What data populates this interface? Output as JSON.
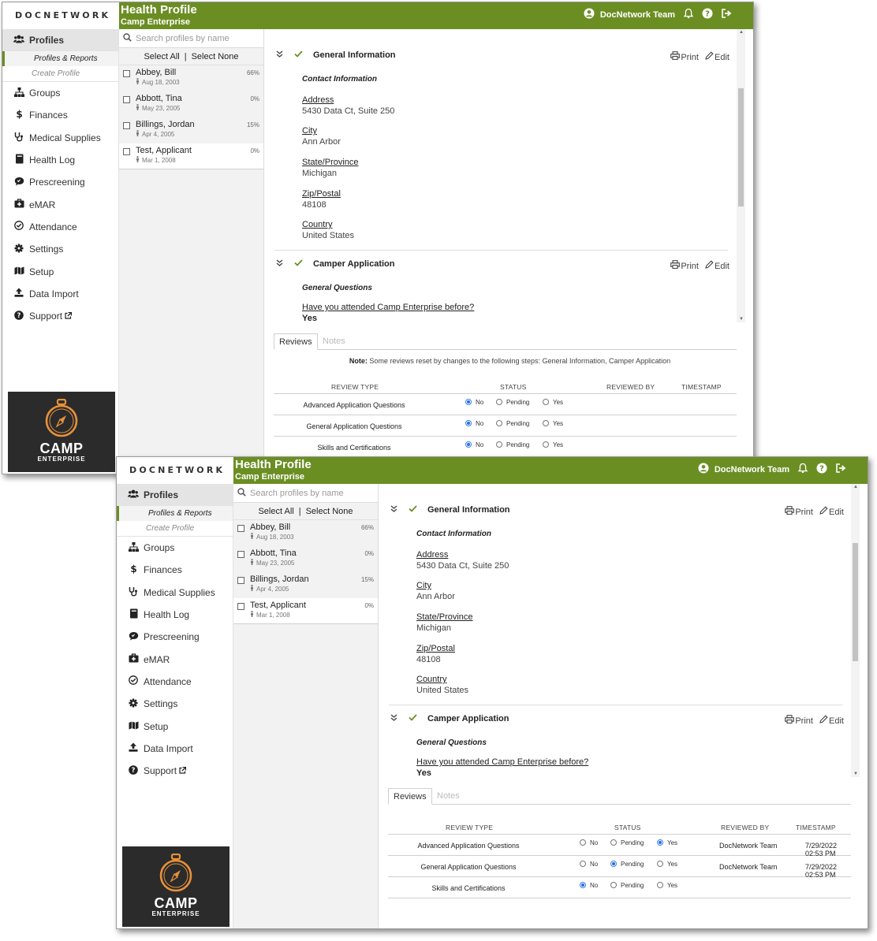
{
  "app": {
    "logo_text": "DOCNETWORK",
    "title": "Health Profile",
    "subtitle": "Camp Enterprise",
    "user_name": "DocNetwork Team"
  },
  "sidebar": {
    "active_item": "Profiles",
    "sub_items": [
      "Profiles & Reports",
      "Create Profile"
    ],
    "items": [
      {
        "label": "Groups",
        "icon": "sitemap-icon"
      },
      {
        "label": "Finances",
        "icon": "dollar-icon"
      },
      {
        "label": "Medical Supplies",
        "icon": "stethoscope-icon"
      },
      {
        "label": "Health Log",
        "icon": "book-icon"
      },
      {
        "label": "Prescreening",
        "icon": "chat-icon"
      },
      {
        "label": "eMAR",
        "icon": "medkit-icon"
      },
      {
        "label": "Attendance",
        "icon": "check-circle-icon"
      },
      {
        "label": "Settings",
        "icon": "gear-icon"
      },
      {
        "label": "Setup",
        "icon": "map-icon"
      },
      {
        "label": "Data Import",
        "icon": "upload-icon"
      },
      {
        "label": "Support",
        "icon": "question-circle-icon"
      }
    ],
    "brand": {
      "line1": "CAMP",
      "line2": "ENTERPRISE"
    }
  },
  "profiles": {
    "search_placeholder": "Search profiles by name",
    "select_all": "Select All",
    "select_separator": "|",
    "select_none": "Select None",
    "list": [
      {
        "name": "Abbey, Bill",
        "date": "Aug 18, 2003",
        "pct": "66%"
      },
      {
        "name": "Abbott, Tina",
        "date": "May 23, 2005",
        "pct": "0%"
      },
      {
        "name": "Billings, Jordan",
        "date": "Apr 4, 2005",
        "pct": "15%"
      },
      {
        "name": "Test, Applicant",
        "date": "Mar 1, 2008",
        "pct": "0%"
      }
    ]
  },
  "form": {
    "print_label": "Print",
    "edit_label": "Edit",
    "general": {
      "title": "General Information",
      "subheading": "Contact Information",
      "fields": [
        {
          "label": "Address",
          "value": "5430 Data Ct, Suite 250"
        },
        {
          "label": "City",
          "value": "Ann Arbor"
        },
        {
          "label": "State/Province",
          "value": "Michigan"
        },
        {
          "label": "Zip/Postal",
          "value": "48108"
        },
        {
          "label": "Country",
          "value": "United States"
        }
      ]
    },
    "camper": {
      "title": "Camper Application",
      "subheading": "General Questions",
      "question": "Have you attended Camp Enterprise before?",
      "answer": "Yes"
    }
  },
  "reviews": {
    "tabs": [
      "Reviews",
      "Notes"
    ],
    "note_label": "Note:",
    "note_text": "Some reviews reset by changes to the following steps: General Information, Camper Application",
    "headers": [
      "REVIEW TYPE",
      "STATUS",
      "REVIEWED BY",
      "TIMESTAMP"
    ],
    "status_options": [
      "No",
      "Pending",
      "Yes"
    ],
    "before": [
      {
        "type": "Advanced Application Questions",
        "status": "No",
        "by": "",
        "ts": ""
      },
      {
        "type": "General Application Questions",
        "status": "No",
        "by": "",
        "ts": ""
      },
      {
        "type": "Skills and Certifications",
        "status": "No",
        "by": "",
        "ts": ""
      }
    ],
    "after": [
      {
        "type": "Advanced Application Questions",
        "status": "Yes",
        "by": "DocNetwork Team",
        "ts": "7/29/2022 02:53 PM"
      },
      {
        "type": "General Application Questions",
        "status": "Pending",
        "by": "DocNetwork Team",
        "ts": "7/29/2022 02:53 PM"
      },
      {
        "type": "Skills and Certifications",
        "status": "No",
        "by": "",
        "ts": ""
      }
    ]
  },
  "colors": {
    "accent": "#6b8e23",
    "radio_selected": "#1f6fe5"
  }
}
